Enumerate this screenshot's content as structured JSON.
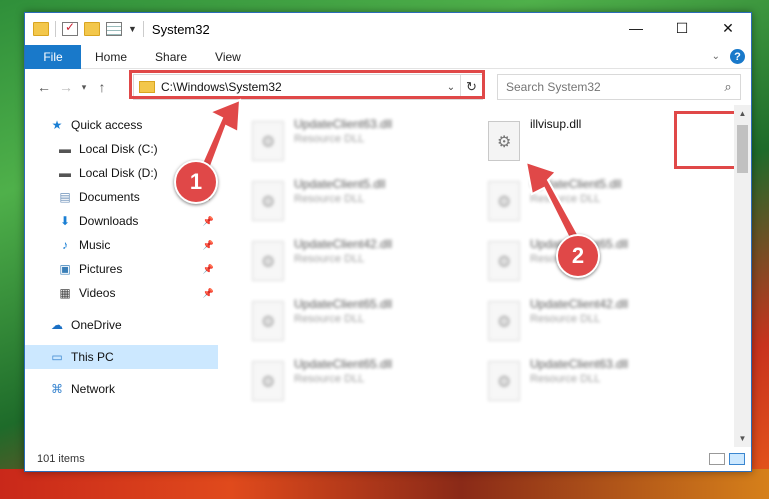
{
  "window": {
    "title": "System32",
    "controls": {
      "minimize": "—",
      "maximize": "☐",
      "close": "✕"
    }
  },
  "ribbon": {
    "tabs": [
      "File",
      "Home",
      "Share",
      "View"
    ],
    "help": "?"
  },
  "nav": {
    "back": "←",
    "forward": "→",
    "recent": "▾",
    "up": "↑",
    "address": "C:\\Windows\\System32",
    "search_placeholder": "Search System32"
  },
  "sidebar": {
    "items": [
      {
        "label": "Quick access",
        "icon": "star-icon",
        "pinned": false
      },
      {
        "label": "Local Disk (C:)",
        "icon": "drive-icon",
        "pinned": false
      },
      {
        "label": "Local Disk (D:)",
        "icon": "drive-icon",
        "pinned": false
      },
      {
        "label": "Documents",
        "icon": "documents-icon",
        "pinned": true
      },
      {
        "label": "Downloads",
        "icon": "downloads-icon",
        "pinned": true
      },
      {
        "label": "Music",
        "icon": "music-icon",
        "pinned": true
      },
      {
        "label": "Pictures",
        "icon": "pictures-icon",
        "pinned": true
      },
      {
        "label": "Videos",
        "icon": "videos-icon",
        "pinned": true
      },
      {
        "label": "OneDrive",
        "icon": "onedrive-icon",
        "pinned": false
      },
      {
        "label": "This PC",
        "icon": "computer-icon",
        "pinned": false
      },
      {
        "label": "Network",
        "icon": "network-icon",
        "pinned": false
      }
    ]
  },
  "files": [
    {
      "name": "UpdateClient63.dll",
      "type": "Resource DLL"
    },
    {
      "name": "illvisup.dll",
      "type": ""
    },
    {
      "name": "UpdateClient5.dll",
      "type": "Resource DLL"
    },
    {
      "name": "UpdateClient5.dll",
      "type": "Resource DLL"
    },
    {
      "name": "UpdateClient42.dll",
      "type": "Resource DLL"
    },
    {
      "name": "UpdateClient65.dll",
      "type": "Resource DLL"
    },
    {
      "name": "UpdateClient65.dll",
      "type": "Resource DLL"
    },
    {
      "name": "UpdateClient42.dll",
      "type": "Resource DLL"
    },
    {
      "name": "UpdateClient65.dll",
      "type": "Resource DLL"
    },
    {
      "name": "UpdateClient63.dll",
      "type": "Resource DLL"
    }
  ],
  "status": {
    "count": "101 items"
  },
  "annotations": {
    "step1": "1",
    "step2": "2",
    "color": "#e04848"
  }
}
